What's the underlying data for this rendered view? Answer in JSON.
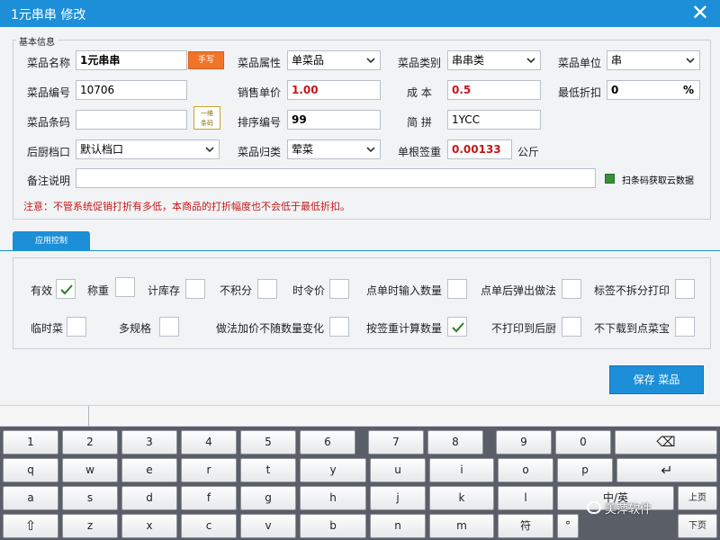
{
  "window": {
    "title": "1元串串 修改"
  },
  "group_basic": {
    "label": "基本信息"
  },
  "fields": {
    "dish_name": {
      "label": "菜品名称",
      "value": "1元串串"
    },
    "handwrite_button": "手写",
    "dish_attr": {
      "label": "菜品属性",
      "value": "单菜品"
    },
    "dish_category": {
      "label": "菜品类别",
      "value": "串串类"
    },
    "dish_unit": {
      "label": "菜品单位",
      "value": "串"
    },
    "dish_code": {
      "label": "菜品编号",
      "value": "10706"
    },
    "sale_price": {
      "label": "销售单价",
      "value": "1.00"
    },
    "cost": {
      "label": "成 本",
      "value": "0.5"
    },
    "min_discount": {
      "label": "最低折扣",
      "value": "0",
      "unit": "%"
    },
    "barcode": {
      "label": "菜品条码",
      "value": ""
    },
    "barcode_button": "一维\n条码",
    "sort_no": {
      "label": "排序编号",
      "value": "99"
    },
    "pinyin": {
      "label": "简 拼",
      "value": "1YCC"
    },
    "kitchen": {
      "label": "后厨档口",
      "value": "默认档口"
    },
    "dish_group": {
      "label": "菜品归类",
      "value": "荤菜"
    },
    "unit_weight": {
      "label": "单根签重",
      "value": "0.00133",
      "unit": "公斤"
    },
    "remark": {
      "label": "备注说明",
      "value": ""
    },
    "scan_cloud": "扫条码获取云数据"
  },
  "notice": "注意：不管系统促销打折有多低，本商品的打折幅度也不会低于最低折扣。",
  "tabs": [
    {
      "label": "应用控制"
    }
  ],
  "options": [
    {
      "label": "有效",
      "checked": true
    },
    {
      "label": "称重",
      "checked": false
    },
    {
      "label": "计库存",
      "checked": false
    },
    {
      "label": "不积分",
      "checked": false
    },
    {
      "label": "时令价",
      "checked": false
    },
    {
      "label": "点单时输入数量",
      "checked": false
    },
    {
      "label": "点单后弹出做法",
      "checked": false
    },
    {
      "label": "标签不拆分打印",
      "checked": false
    },
    {
      "label": "临时菜",
      "checked": false
    },
    {
      "label": "多规格",
      "checked": false
    },
    {
      "label": "做法加价不随数量变化",
      "checked": false
    },
    {
      "label": "按签重计算数量",
      "checked": true
    },
    {
      "label": "不打印到后厨",
      "checked": false
    },
    {
      "label": "不下载到点菜宝",
      "checked": false
    }
  ],
  "save_button": "保存 菜品",
  "keyboard": {
    "row1": [
      "1",
      "2",
      "3",
      "4",
      "5",
      "6",
      "7",
      "8",
      "9",
      "0",
      "⌫"
    ],
    "row2": [
      "q",
      "w",
      "e",
      "r",
      "t",
      "y",
      "u",
      "i",
      "o",
      "p",
      "↵"
    ],
    "row3": [
      "a",
      "s",
      "d",
      "f",
      "g",
      "h",
      "j",
      "k",
      "l",
      "中/英",
      "上页"
    ],
    "row4": [
      "⇧",
      "z",
      "x",
      "c",
      "v",
      "b",
      "n",
      "m",
      "符",
      "°",
      "下页"
    ]
  },
  "watermark": "美萍软件"
}
